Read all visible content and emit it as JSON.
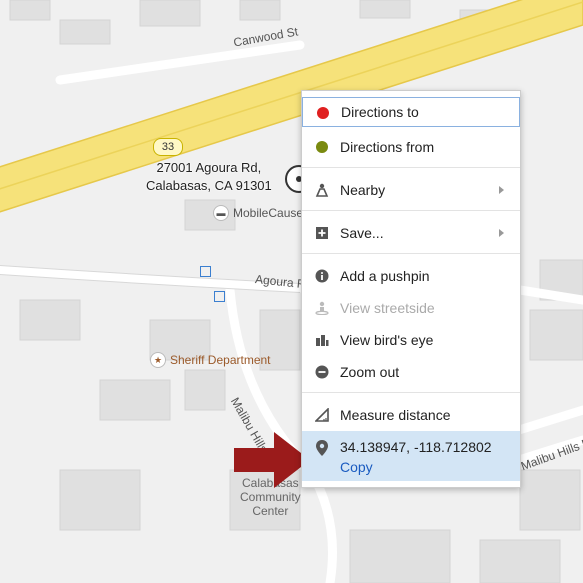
{
  "map": {
    "road_labels": [
      "Canwood St",
      "Agoura Rd",
      "Malibu Hills Rd",
      "Malibu Hills Rd"
    ],
    "route_shield": "33",
    "address_line1": "27001 Agoura Rd,",
    "address_line2": "Calabasas, CA 91301",
    "poi_mobilecause": "MobileCause",
    "poi_sheriff": "Sheriff Department",
    "poi_community": "Calabasas Community Center",
    "community_line1": "Calabasas",
    "community_line2": "Community",
    "community_line3": "Center",
    "highway_color": "#f6e27a",
    "highway_border": "#e6c84a"
  },
  "menu": {
    "directions_to": "Directions to",
    "directions_from": "Directions from",
    "nearby": "Nearby",
    "save": "Save...",
    "add_pushpin": "Add a pushpin",
    "view_streetside": "View streetside",
    "view_birds_eye": "View bird's eye",
    "zoom_out": "Zoom out",
    "measure_distance": "Measure distance",
    "coordinates": "34.138947, -118.712802",
    "copy": "Copy",
    "directions_to_color": "#e02020",
    "directions_from_color": "#7a8a10",
    "highlight_color": "#d3e5f5"
  },
  "annotation": {
    "arrow_color": "#9b1b1b"
  }
}
